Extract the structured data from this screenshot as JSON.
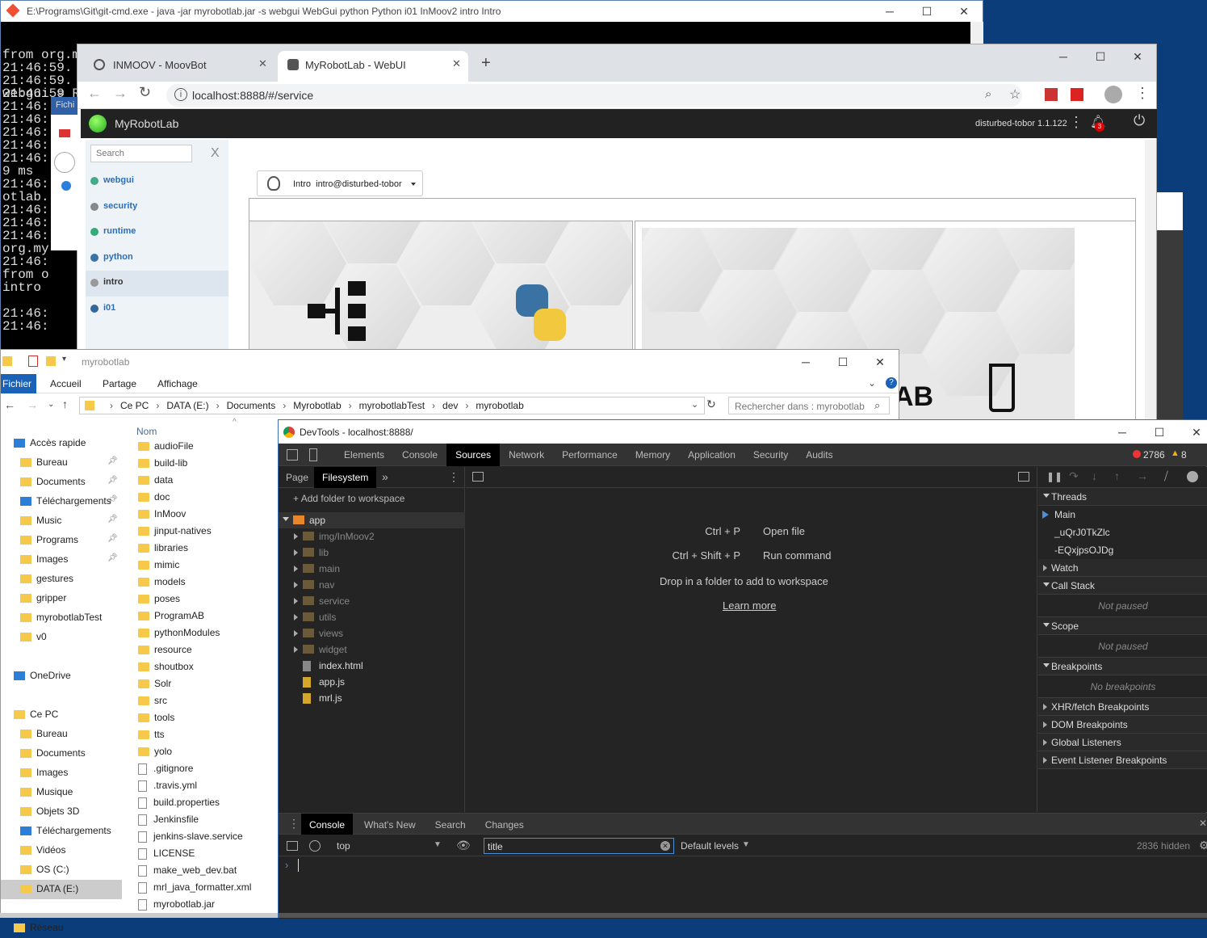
{
  "cmd": {
    "title": "E:\\Programs\\Git\\git-cmd.exe - java  -jar myrobotlab.jar -s webgui WebGui python Python i01 InMoov2 intro Intro",
    "top_lines": [
      "from org.myrobotlab.service import WebGui",
      "webgui = Runtime.getService(\"webgui\")"
    ],
    "lines": [
      "",
      "21:46:59.",
      "21:46:59.",
      "21:46:59",
      "21:46:",
      "21:46:",
      "21:46:",
      "21:46:",
      "21:46:",
      "9 ms",
      "21:46:",
      "otlab.",
      "21:46:",
      "21:46:",
      "21:46:",
      "org.my",
      "21:46:",
      "from o",
      "intro",
      "",
      "21:46:",
      "21:46:"
    ]
  },
  "browser": {
    "tabs": [
      {
        "label": "INMOOV - MoovBot"
      },
      {
        "label": "MyRobotLab - WebUI"
      }
    ],
    "url": "localhost:8888/#/service"
  },
  "mrl": {
    "brand": "MyRobotLab",
    "instance": "disturbed-tobor 1.1.122",
    "notif_count": "3",
    "search_placeholder": "Search",
    "search_clear": "X",
    "services": [
      "webgui",
      "security",
      "runtime",
      "python",
      "intro",
      "i01"
    ],
    "selector_label": "Intro  intro@disturbed-tobor"
  },
  "bg_window": {
    "menu": "Fichi"
  },
  "explorer": {
    "title": "myrobotlab",
    "ribbon": [
      "Fichier",
      "Accueil",
      "Partage",
      "Affichage"
    ],
    "breadcrumb": [
      "Ce PC",
      "DATA (E:)",
      "Documents",
      "Myrobotlab",
      "myrobotlabTest",
      "dev",
      "myrobotlab"
    ],
    "search_placeholder": "Rechercher dans : myrobotlab",
    "col_name": "Nom",
    "nav": [
      {
        "label": "Accès rapide",
        "indent": 0
      },
      {
        "label": "Bureau",
        "indent": 1
      },
      {
        "label": "Documents",
        "indent": 1
      },
      {
        "label": "Téléchargements",
        "indent": 1
      },
      {
        "label": "Music",
        "indent": 1
      },
      {
        "label": "Programs",
        "indent": 1
      },
      {
        "label": "Images",
        "indent": 1
      },
      {
        "label": "gestures",
        "indent": 1
      },
      {
        "label": "gripper",
        "indent": 1
      },
      {
        "label": "myrobotlabTest",
        "indent": 1
      },
      {
        "label": "v0",
        "indent": 1
      },
      {
        "label": "",
        "indent": 0
      },
      {
        "label": "OneDrive",
        "indent": 0
      },
      {
        "label": "",
        "indent": 0
      },
      {
        "label": "Ce PC",
        "indent": 0
      },
      {
        "label": "Bureau",
        "indent": 1
      },
      {
        "label": "Documents",
        "indent": 1
      },
      {
        "label": "Images",
        "indent": 1
      },
      {
        "label": "Musique",
        "indent": 1
      },
      {
        "label": "Objets 3D",
        "indent": 1
      },
      {
        "label": "Téléchargements",
        "indent": 1
      },
      {
        "label": "Vidéos",
        "indent": 1
      },
      {
        "label": "OS (C:)",
        "indent": 1
      },
      {
        "label": "DATA (E:)",
        "indent": 1
      },
      {
        "label": "",
        "indent": 0
      },
      {
        "label": "Réseau",
        "indent": 0
      }
    ],
    "files": [
      {
        "name": "audioFile",
        "type": "folder"
      },
      {
        "name": "build-lib",
        "type": "folder"
      },
      {
        "name": "data",
        "type": "folder"
      },
      {
        "name": "doc",
        "type": "folder"
      },
      {
        "name": "InMoov",
        "type": "folder"
      },
      {
        "name": "jinput-natives",
        "type": "folder"
      },
      {
        "name": "libraries",
        "type": "folder"
      },
      {
        "name": "mimic",
        "type": "folder"
      },
      {
        "name": "models",
        "type": "folder"
      },
      {
        "name": "poses",
        "type": "folder"
      },
      {
        "name": "ProgramAB",
        "type": "folder"
      },
      {
        "name": "pythonModules",
        "type": "folder"
      },
      {
        "name": "resource",
        "type": "folder"
      },
      {
        "name": "shoutbox",
        "type": "folder"
      },
      {
        "name": "Solr",
        "type": "folder"
      },
      {
        "name": "src",
        "type": "folder"
      },
      {
        "name": "tools",
        "type": "folder"
      },
      {
        "name": "tts",
        "type": "folder"
      },
      {
        "name": "yolo",
        "type": "folder"
      },
      {
        "name": ".gitignore",
        "type": "file"
      },
      {
        "name": ".travis.yml",
        "type": "file"
      },
      {
        "name": "build.properties",
        "type": "file"
      },
      {
        "name": "Jenkinsfile",
        "type": "file"
      },
      {
        "name": "jenkins-slave.service",
        "type": "file"
      },
      {
        "name": "LICENSE",
        "type": "file"
      },
      {
        "name": "make_web_dev.bat",
        "type": "file"
      },
      {
        "name": "mrl_java_formatter.xml",
        "type": "file"
      },
      {
        "name": "myrobotlab.jar",
        "type": "file"
      }
    ]
  },
  "devtools": {
    "title": "DevTools - localhost:8888/",
    "tabs": [
      "Elements",
      "Console",
      "Sources",
      "Network",
      "Performance",
      "Memory",
      "Application",
      "Security",
      "Audits"
    ],
    "errors": "2786",
    "warnings": "8",
    "nav_tabs": [
      "Page",
      "Filesystem"
    ],
    "add_folder": "Add folder to workspace",
    "tree": [
      {
        "name": "app",
        "type": "root"
      },
      {
        "name": "img/InMoov2",
        "type": "folder"
      },
      {
        "name": "lib",
        "type": "folder"
      },
      {
        "name": "main",
        "type": "folder"
      },
      {
        "name": "nav",
        "type": "folder"
      },
      {
        "name": "service",
        "type": "folder"
      },
      {
        "name": "utils",
        "type": "folder"
      },
      {
        "name": "views",
        "type": "folder"
      },
      {
        "name": "widget",
        "type": "folder"
      },
      {
        "name": "index.html",
        "type": "file"
      },
      {
        "name": "app.js",
        "type": "js"
      },
      {
        "name": "mrl.js",
        "type": "js"
      }
    ],
    "shortcuts": [
      {
        "keys": "Ctrl + P",
        "action": "Open file"
      },
      {
        "keys": "Ctrl + Shift + P",
        "action": "Run command"
      }
    ],
    "drop_text": "Drop in a folder to add to workspace",
    "learn_more": "Learn more",
    "sidebar": [
      {
        "label": "Threads",
        "open": true
      },
      {
        "label": "Main",
        "type": "thread-active"
      },
      {
        "label": "_uQrJ0TkZlc",
        "type": "thread"
      },
      {
        "label": "-EQxjpsOJDg",
        "type": "thread"
      },
      {
        "label": "Watch",
        "open": false
      },
      {
        "label": "Call Stack",
        "open": true
      },
      {
        "label": "Not paused",
        "type": "note"
      },
      {
        "label": "Scope",
        "open": true
      },
      {
        "label": "Not paused",
        "type": "note"
      },
      {
        "label": "Breakpoints",
        "open": true
      },
      {
        "label": "No breakpoints",
        "type": "note"
      },
      {
        "label": "XHR/fetch Breakpoints",
        "open": false
      },
      {
        "label": "DOM Breakpoints",
        "open": false
      },
      {
        "label": "Global Listeners",
        "open": false
      },
      {
        "label": "Event Listener Breakpoints",
        "open": false
      }
    ],
    "drawer_tabs": [
      "Console",
      "What's New",
      "Search",
      "Changes"
    ],
    "context": "top",
    "filter_value": "title",
    "levels": "Default levels",
    "hidden": "2836 hidden"
  }
}
